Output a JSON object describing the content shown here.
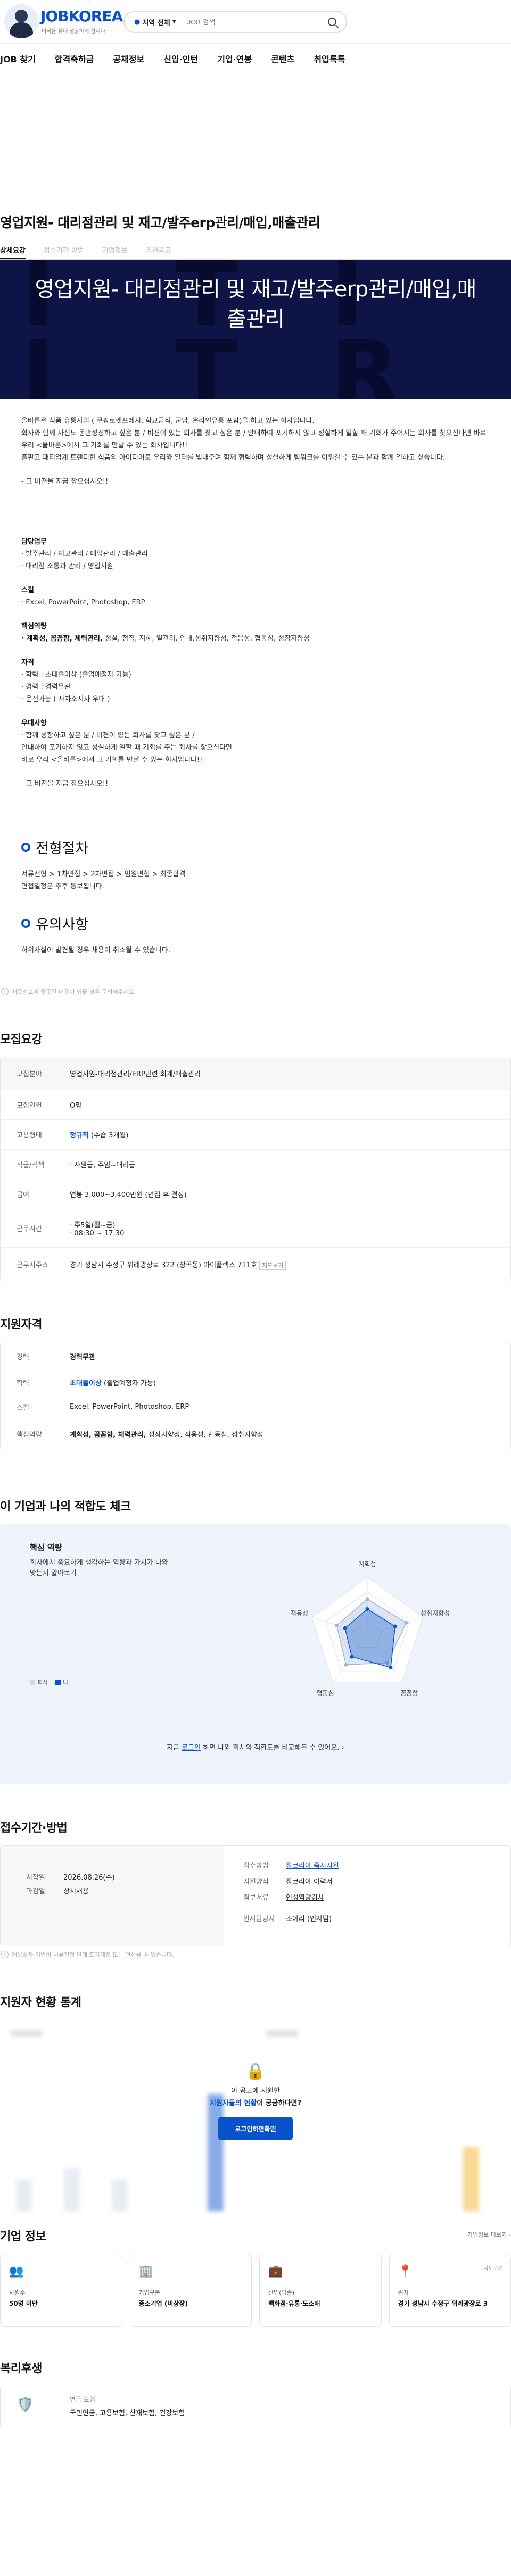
{
  "brand": {
    "logo": "JOBKOREA",
    "tagline": "이직을 찾아 성공하게 합니다"
  },
  "search": {
    "region": "지역 전체",
    "placeholder": "JOB 검색"
  },
  "gnb": [
    "JOB 찾기",
    "합격축하금",
    "공채정보",
    "신입·인턴",
    "기업·연봉",
    "콘텐츠",
    "취업톡톡"
  ],
  "job": {
    "title": "영업지원- 대리점관리 및 재고/발주erp관리/매입,매출관리",
    "tabs": [
      "상세요강",
      "접수기간·방법",
      "기업정보",
      "추천공고"
    ],
    "hero_title": "영업지원- 대리점관리 및 재고/발주erp관리/매입,매출관리",
    "hero_bg": "I T I T U R"
  },
  "desc": {
    "intro": [
      "올바른은 식품 유통사업 ( 쿠팡로켓프레시, 학교급식, 군납, 온라인유통 포함)을 하고 있는 회사입니다.",
      "회사와 함께 자신도 동반성장하고 싶은 분 / 비젼이 있는 회사를 찾고 싶은 분 / 안내하여 포기하지 않고 성실하게 일할 때 기회가 주어지는 회사를 찾으신다면 바로 우리 <올바른>에서 그 기회를 만날 수 있는 회사입니다!!",
      "출판고 패티업계 트렌디한 식품의 아이디어로 우리와 일터를 빛내주며 함께 협력하며 성실하게 팀워크를 이뤄갈 수 있는 분과 함께 일하고 싶습니다."
    ],
    "cta1": "- 그 비젼을 지금 잡으십시오!!",
    "duty_h": "담당업무",
    "duty": [
      "· 발주관리 / 재고관리 / 매입관리 / 매출관리",
      "· 대리점 소통과 관리 / 영업지원"
    ],
    "skill_h": "스킬",
    "skill": "· Excel, PowerPoint, Photoshop, ERP",
    "core_h": "핵심역량",
    "core_b": "· 계획성, 꼼꼼함, 체력관리,",
    "core_r": " 성실, 정직, 지혜, 일관리, 인내,성취지향성, 적응성, 협동심, 성장지향성",
    "qual_h": "자격",
    "qual": [
      "· 학력 : 초대졸이상 (졸업예정자 가능)",
      "· 경력 : 경력무관",
      "· 운전가능 ( 자차소지자 우대 )"
    ],
    "pref_h": "우대사항",
    "pref": [
      "· 함께 성장하고 싶은 분 / 비젼이 있는 회사를 찾고 싶은 분 /",
      "  안내하여 포기하지 않고 성실하게 일할 때 기회를 주는 회사를 찾으신다면",
      "  바로 우리 <올바른>에서 그 기회를 만날 수 있는 회사입니다!!"
    ],
    "cta2": "- 그 비젼을 지금 잡으십시오!!"
  },
  "process": {
    "title": "전형절차",
    "lines": [
      "서류전형 > 1차면접 > 2차면접 > 임원면접 > 최종합격",
      "면접일정은 추후 통보됩니다."
    ]
  },
  "caution": {
    "title": "유의사항",
    "lines": [
      "허위사실이 발견될 경우 채용이 취소될 수 있습니다."
    ]
  },
  "notice1": "채용정보에 잘못된 내용이 있을 경우 문의해주세요.",
  "summary": {
    "title": "모집요강",
    "field_k": "모집분야",
    "field_v": "영업지원-대리점관리/ERP관련 회계/매출관리",
    "rows": [
      {
        "k": "모집인원",
        "v": "O명"
      },
      {
        "k": "고용형태",
        "v": "정규직",
        "v2": " (수습 3개월)"
      },
      {
        "k": "직급/직책",
        "v": "· 사원급, 주임~대리급"
      },
      {
        "k": "급여",
        "v": "연봉 3,000~3,400만원 (면접 후 결정)"
      },
      {
        "k": "근무시간",
        "v": "· 주5일(월~금)",
        "v2": "· 08:30 ~ 17:30"
      },
      {
        "k": "근무지주소",
        "v": "경기 성남시 수정구 위례광장로 322 (창곡동) 아이플렉스 711호",
        "v2": "지도보기"
      }
    ]
  },
  "qual2": {
    "title": "지원자격",
    "rows": [
      {
        "k": "경력",
        "v": "경력무관"
      },
      {
        "k": "학력",
        "v": "초대졸이상",
        "v2": " (졸업예정자 가능)"
      },
      {
        "k": "스킬",
        "v": "Excel, PowerPoint, Photoshop, ERP"
      },
      {
        "k": "핵심역량",
        "v": "계획성, 꼼꼼함, 체력관리,",
        "v2": " 성장지향성, 적응성, 협동심, 성취지향성"
      }
    ]
  },
  "fit": {
    "title": "이 기업과 나의 적합도 체크",
    "sub": "핵심 역량",
    "desc": "회사에서 중요하게 생각하는 역량과 가치가 나와 맞는지 알아보기",
    "legend": [
      "회사",
      "나"
    ],
    "axes": [
      "계획성",
      "성취지향성",
      "꼼꼼함",
      "협동심",
      "적응성"
    ],
    "company": [
      0.62,
      0.7,
      0.58,
      0.62,
      0.55
    ],
    "me": [
      0.45,
      0.5,
      0.68,
      0.45,
      0.4
    ],
    "footer_a": "지금 ",
    "footer_link": "로그인",
    "footer_b": " 하면 나와 회사의 적합도를 비교해볼 수 있어요."
  },
  "apply": {
    "title": "접수기간·방법",
    "start_k": "시작일",
    "start_v": "2026.08.26(수)",
    "end_k": "마감일",
    "end_v": "상시채용",
    "method_k": "접수방법",
    "method_v": "잡코리아 즉시지원",
    "form_k": "지원양식",
    "form_v": "잡코리아 이력서",
    "doc_k": "첨부서류",
    "doc_v": "인성역량검사",
    "hr_k": "인사담당자",
    "hr_v": "조아리 (인사팀)"
  },
  "notice2": "채용절차 기업이 서류전형 단계 포기계정 또는 면접을 수 있습니다.",
  "stats": {
    "title": "지원자 현황 통계",
    "prompt_a": "이 공고에 지원한",
    "prompt_b": "지원자들의 현황",
    "prompt_c": "이 궁금하다면?",
    "button": "로그인하면확인"
  },
  "company": {
    "title": "기업 정보",
    "more": "기업정보 더보기",
    "cards": [
      {
        "lbl": "사원수",
        "val": "50명 미만"
      },
      {
        "lbl": "기업구분",
        "val": "중소기업 (비상장)"
      },
      {
        "lbl": "산업(업종)",
        "val": "백화점·유통·도소매"
      },
      {
        "lbl": "위치",
        "val": "경기 성남시 수정구 위례광장로 3"
      }
    ],
    "map": "지도보기"
  },
  "welfare": {
    "title": "복리후생",
    "h": "연금·보험",
    "v": "국민연금, 고용보험, 산재보험, 건강보험"
  },
  "colors": {
    "brand": "#0a52c9",
    "hero": "#0e1446"
  }
}
